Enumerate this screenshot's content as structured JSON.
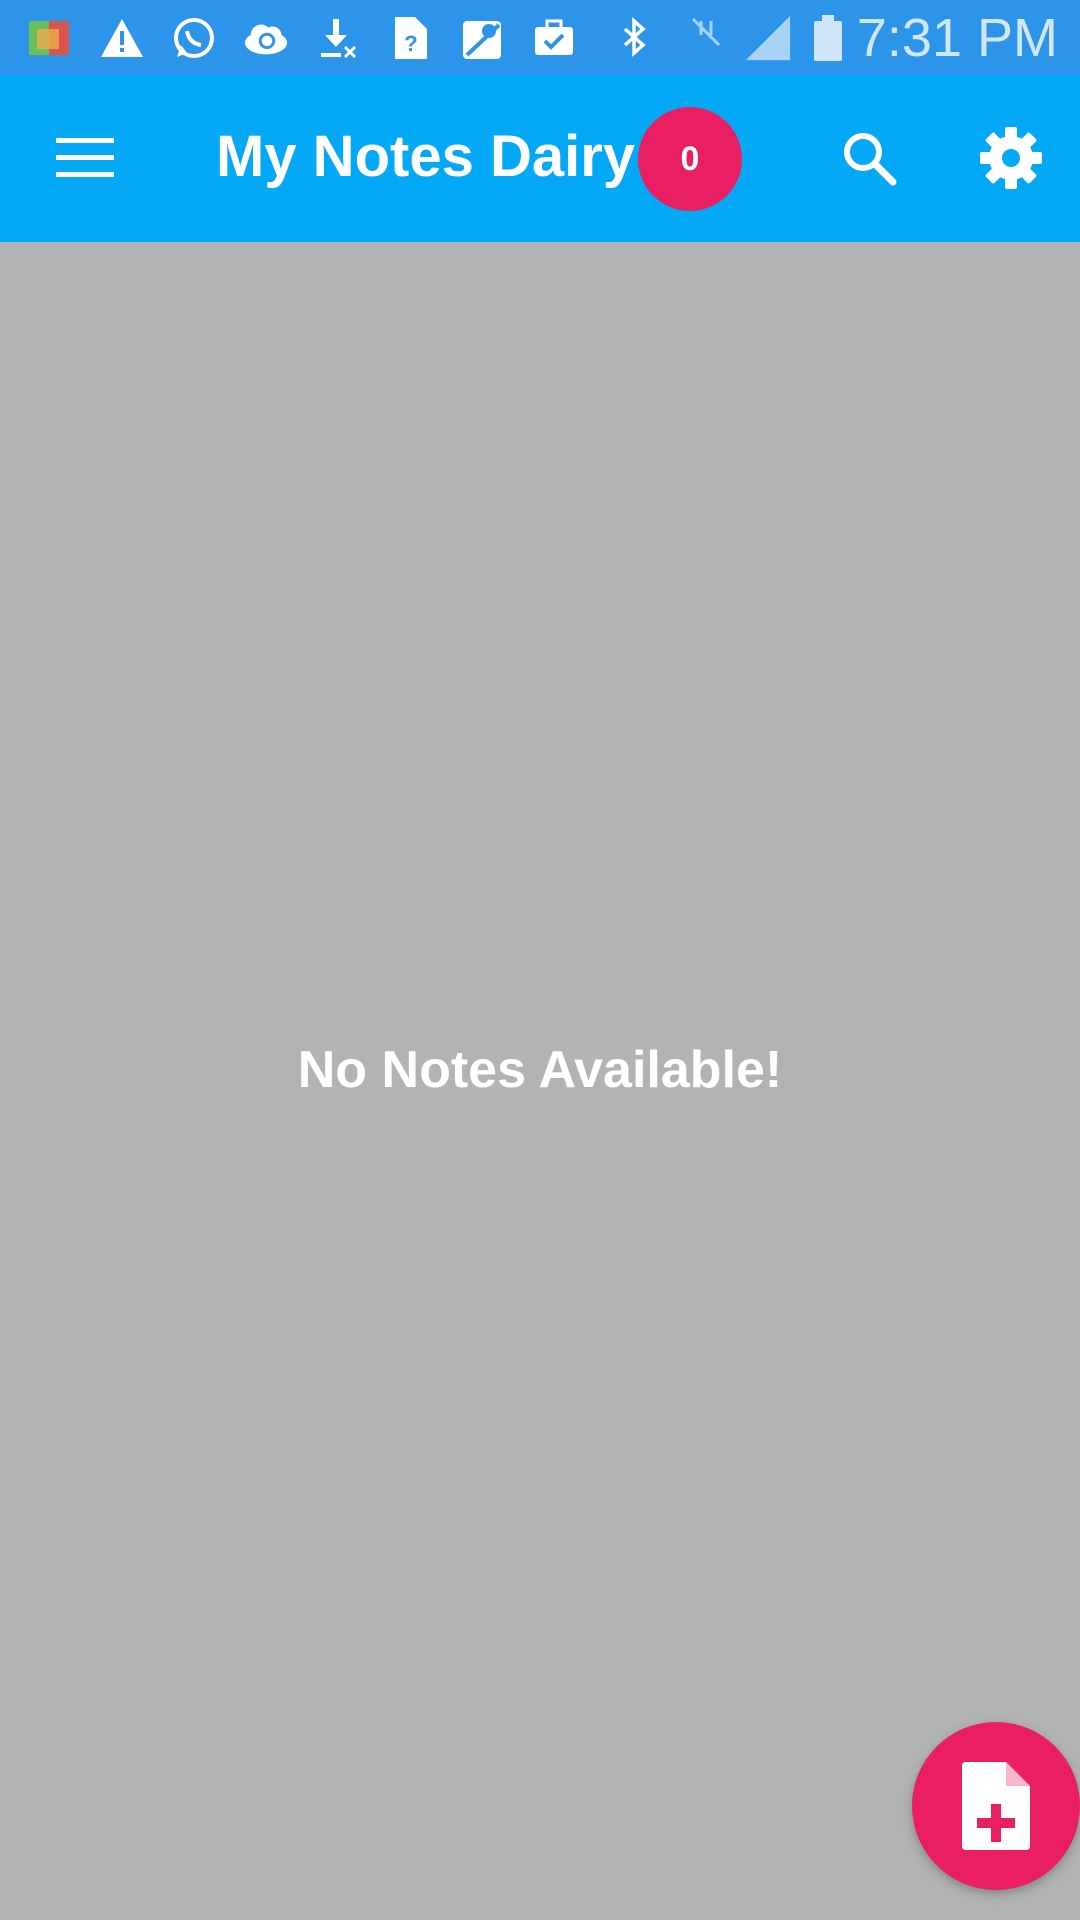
{
  "status_bar": {
    "time": "7:31 PM",
    "icons": [
      "app-icon",
      "warning-icon",
      "whatsapp-icon",
      "cloud-sync-icon",
      "download-icon",
      "document-icon",
      "maps-icon",
      "briefcase-icon",
      "bluetooth-icon",
      "nfc-icon",
      "signal-icon",
      "battery-icon"
    ]
  },
  "app_bar": {
    "title": "My Notes Dairy",
    "note_count": "0",
    "menu_icon": "menu-icon",
    "search_icon": "search-icon",
    "settings_icon": "gear-icon"
  },
  "main": {
    "empty_message": "No Notes Available!"
  },
  "fab": {
    "icon": "add-note-icon"
  },
  "colors": {
    "status_bar": "#2c95ea",
    "app_bar": "#03a9f4",
    "accent": "#e91e63",
    "background": "#b2b3b5"
  }
}
